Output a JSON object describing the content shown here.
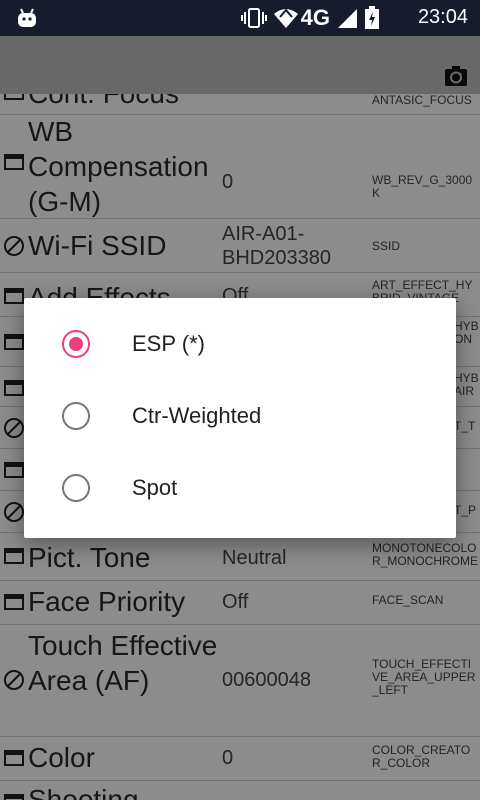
{
  "status_bar": {
    "time": "23:04",
    "network": "4G"
  },
  "list_rows": [
    {
      "icon": "window-icon",
      "name": "Cont. Focus",
      "value": "",
      "key": "ANTASIC_FOCUS"
    },
    {
      "icon": "window-icon",
      "name": "WB Compensation (G-M)",
      "value": "0",
      "key": "WB_REV_G_3000K"
    },
    {
      "icon": "block-icon",
      "name": "Wi-Fi SSID",
      "value": "AIR-A01-BHD203380",
      "key": "SSID"
    },
    {
      "icon": "window-icon",
      "name": "Add Effects",
      "value": "Off",
      "key": "ART_EFFECT_HYBRID_VINTAGE"
    },
    {
      "icon": "window-icon",
      "name": "",
      "value": "",
      "key": "HYB ON"
    },
    {
      "icon": "window-icon",
      "name": "",
      "value": "",
      "key": "HYB AIR"
    },
    {
      "icon": "block-icon",
      "name": "",
      "value": "",
      "key": "T_T"
    },
    {
      "icon": "window-icon",
      "name": "",
      "value": "",
      "key": ""
    },
    {
      "icon": "block-icon",
      "name": "",
      "value": "",
      "key": "T_P"
    },
    {
      "icon": "window-icon",
      "name": "Pict. Tone",
      "value": "Neutral",
      "key": "MONOTONECOLOR_MONOCHROME"
    },
    {
      "icon": "window-icon",
      "name": "Face Priority",
      "value": "Off",
      "key": "FACE_SCAN"
    },
    {
      "icon": "block-icon",
      "name": "Touch Effective Area (AF)",
      "value": "00600048",
      "key": "TOUCH_EFFECTIVE_AREA_UPPER_LEFT"
    },
    {
      "icon": "window-icon",
      "name": "Color",
      "value": "0",
      "key": "COLOR_CREATOR_COLOR"
    },
    {
      "icon": "window-icon",
      "name": "Shooting",
      "value": "",
      "key": ""
    }
  ],
  "dialog": {
    "options": [
      {
        "label": "ESP (*)",
        "checked": true
      },
      {
        "label": "Ctr-Weighted",
        "checked": false
      },
      {
        "label": "Spot",
        "checked": false
      }
    ]
  },
  "colors": {
    "accent": "#ee3d80",
    "status_bar": "#171c2c",
    "app_bar": "#bdbdbd"
  }
}
